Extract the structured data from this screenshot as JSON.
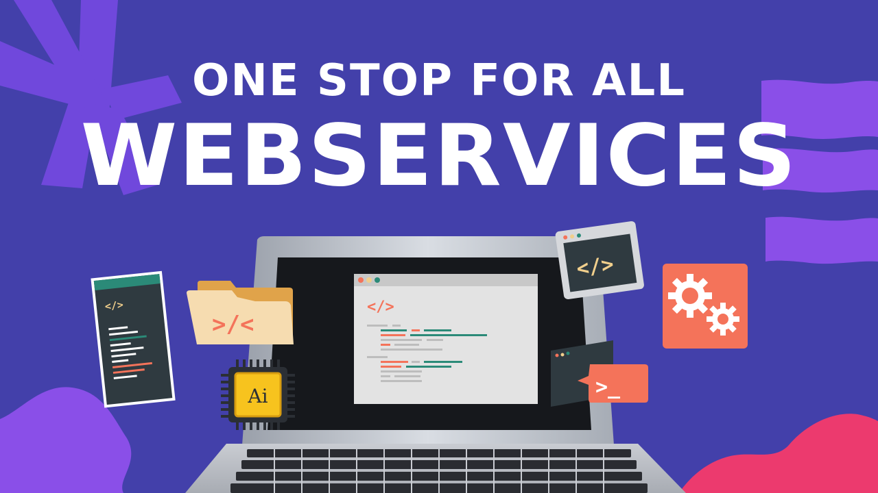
{
  "headline": {
    "line1": "ONE STOP FOR ALL",
    "line2": "WEBSERVICES"
  },
  "icons": {
    "left_panel_code": "</>",
    "folder_code": ">/<",
    "screen_code": "</>",
    "monitor_code": "</>",
    "chip_label": "Ai",
    "terminal_prompt": ">_"
  },
  "colors": {
    "background": "#4340aa",
    "accent_purple": "#7a44e6",
    "accent_pink": "#ec3a6e",
    "coral": "#f4735a",
    "teal": "#2b8a78",
    "chip_yellow": "#f7c31e"
  }
}
